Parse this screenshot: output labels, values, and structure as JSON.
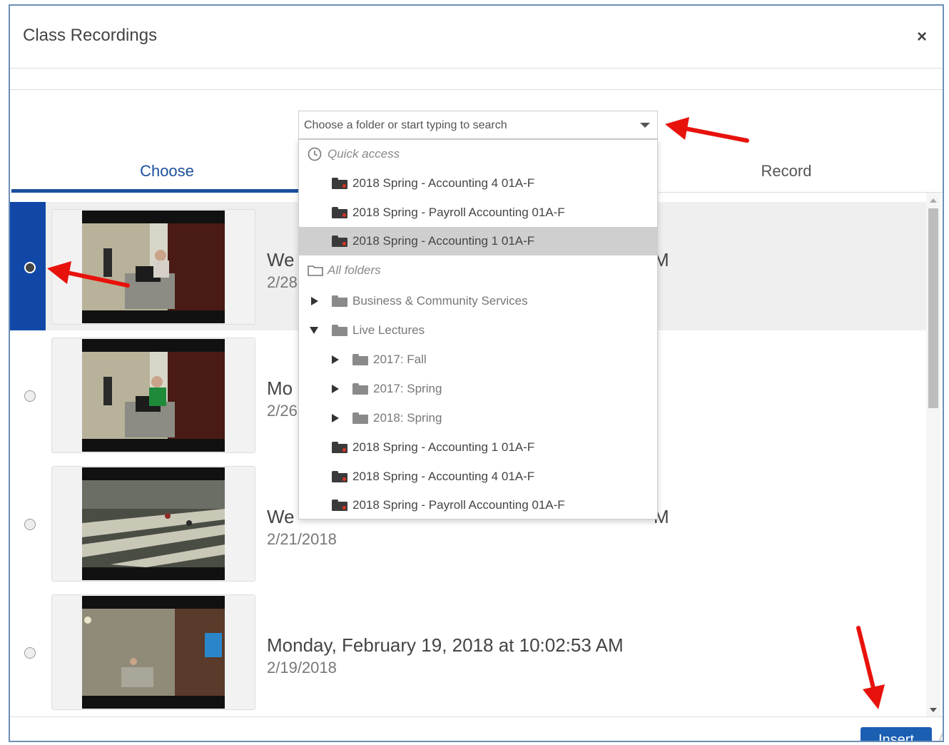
{
  "dialog": {
    "title": "Class Recordings",
    "close_label": "×"
  },
  "search": {
    "placeholder": "Choose a folder or start typing to search"
  },
  "tabs": [
    {
      "label": "Choose",
      "active": true
    },
    {
      "label": "Record",
      "active": false
    }
  ],
  "dropdown": {
    "quick_access_label": "Quick access",
    "quick_access": [
      "2018 Spring - Accounting 4 01A-F",
      "2018 Spring - Payroll Accounting 01A-F",
      "2018 Spring - Accounting 1 01A-F"
    ],
    "all_folders_label": "All folders",
    "tree": [
      {
        "label": "Business & Community Services"
      },
      {
        "label": "Live Lectures"
      },
      {
        "label": "2017: Fall"
      },
      {
        "label": "2017: Spring"
      },
      {
        "label": "2018: Spring"
      },
      {
        "label": "2018 Spring - Accounting 1 01A-F"
      },
      {
        "label": "2018 Spring - Accounting 4 01A-F"
      },
      {
        "label": "2018 Spring - Payroll Accounting 01A-F"
      }
    ]
  },
  "recordings": [
    {
      "title": "We",
      "title_tail": "M",
      "date": "2/28",
      "selected": true
    },
    {
      "title": "Mo",
      "title_tail": "",
      "date": "2/26",
      "selected": false
    },
    {
      "title": "We",
      "title_tail": "M",
      "date": "2/21/2018",
      "selected": false
    },
    {
      "title": "Monday, February 19, 2018 at 10:02:53 AM",
      "title_tail": "",
      "date": "2/19/2018",
      "selected": false
    }
  ],
  "footer": {
    "insert_label": "Insert"
  },
  "colors": {
    "accent": "#1a4f9c",
    "selected_strip": "#1148a8",
    "annotation_arrow": "#e8120c",
    "highlight_row": "#cfcfcf"
  },
  "icons": [
    "close-icon",
    "clock-icon",
    "folder-outline-icon",
    "folder-icon",
    "caret-down-icon",
    "triangle-right-icon",
    "triangle-down-icon",
    "radio-icon"
  ]
}
